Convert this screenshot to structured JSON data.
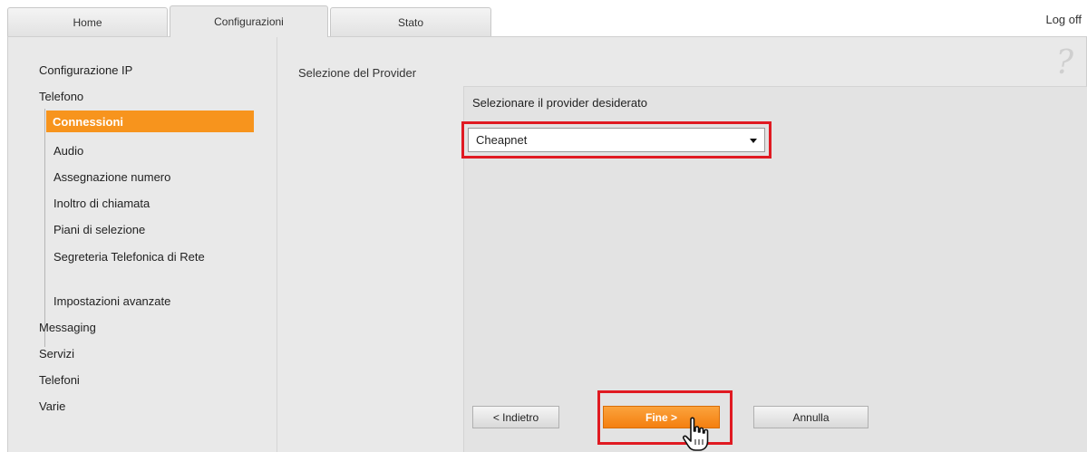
{
  "tabs": [
    {
      "label": "Home",
      "active": false
    },
    {
      "label": "Configurazioni",
      "active": true
    },
    {
      "label": "Stato",
      "active": false
    }
  ],
  "logoff": "Log off",
  "sidebar": {
    "top_items": [
      "Configurazione IP",
      "Telefono"
    ],
    "sub_items": [
      "Connessioni",
      "Audio",
      "Assegnazione numero",
      "Inoltro di chiamata",
      "Piani di selezione",
      "Segreteria Telefonica di Rete",
      "Impostazioni avanzate"
    ],
    "bottom_items": [
      "Messaging",
      "Servizi",
      "Telefoni",
      "Varie"
    ],
    "active_item": "Connessioni"
  },
  "content": {
    "section_title": "Selezione del Provider",
    "prompt": "Selezionare il provider desiderato",
    "provider_selected": "Cheapnet"
  },
  "buttons": {
    "back": "< Indietro",
    "next": "Fine >",
    "cancel": "Annulla"
  },
  "colors": {
    "accent": "#f7941d",
    "highlight": "#e01a22",
    "panel": "#e9e9e9"
  },
  "icons": {
    "help": "?"
  }
}
